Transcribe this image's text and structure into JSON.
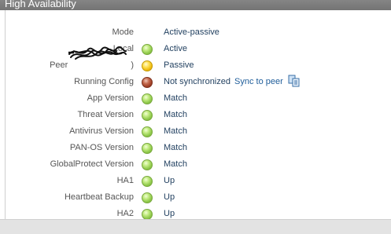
{
  "header": {
    "title": "High Availability"
  },
  "rows": [
    {
      "label": "Mode",
      "value": "Active-passive"
    },
    {
      "label": "Local",
      "value": "Active",
      "status": "green"
    },
    {
      "label": "Peer",
      "label_tail": ")",
      "value": "Passive",
      "status": "yellow"
    },
    {
      "label": "Running Config",
      "value": "Not synchronized",
      "status": "red",
      "link": "Sync to peer",
      "icon": "sync-icon"
    },
    {
      "label": "App Version",
      "value": "Match",
      "status": "green"
    },
    {
      "label": "Threat Version",
      "value": "Match",
      "status": "green"
    },
    {
      "label": "Antivirus Version",
      "value": "Match",
      "status": "green"
    },
    {
      "label": "PAN-OS Version",
      "value": "Match",
      "status": "green"
    },
    {
      "label": "GlobalProtect Version",
      "value": "Match",
      "status": "green"
    },
    {
      "label": "HA1",
      "value": "Up",
      "status": "green"
    },
    {
      "label": "Heartbeat Backup",
      "value": "Up",
      "status": "green"
    },
    {
      "label": "HA2",
      "value": "Up",
      "status": "green"
    }
  ],
  "colors": {
    "header_bg": "#7d7d7d",
    "value_text": "#1f3e5e",
    "link_text": "#1f5d9a",
    "status_green": "#8fc94a",
    "status_yellow": "#f0bd10",
    "status_red": "#9c3c24"
  }
}
